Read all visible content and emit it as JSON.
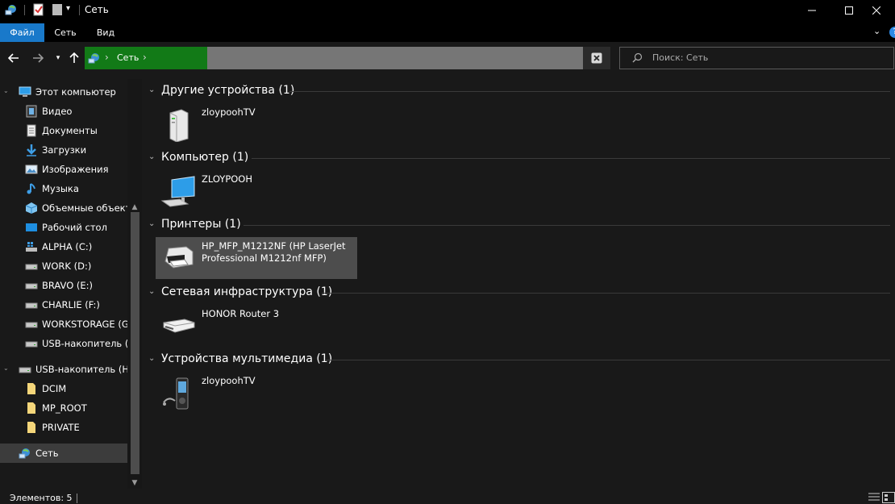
{
  "window": {
    "title": "Сеть"
  },
  "ribbon": {
    "tabs": [
      {
        "label": "Файл"
      },
      {
        "label": "Сеть"
      },
      {
        "label": "Вид"
      }
    ],
    "help": "?"
  },
  "address": {
    "location": "Сеть"
  },
  "search": {
    "placeholder": "Поиск: Сеть"
  },
  "sidebar": {
    "items": [
      {
        "label": "Этот компьютер",
        "icon": "computer-icon"
      },
      {
        "label": "Видео",
        "icon": "video-icon"
      },
      {
        "label": "Документы",
        "icon": "documents-icon"
      },
      {
        "label": "Загрузки",
        "icon": "downloads-icon"
      },
      {
        "label": "Изображения",
        "icon": "images-icon"
      },
      {
        "label": "Музыка",
        "icon": "music-icon"
      },
      {
        "label": "Объемные объекть",
        "icon": "3d-objects-icon"
      },
      {
        "label": "Рабочий стол",
        "icon": "desktop-icon"
      },
      {
        "label": "ALPHA (C:)",
        "icon": "system-drive-icon"
      },
      {
        "label": "WORK (D:)",
        "icon": "drive-icon"
      },
      {
        "label": "BRAVO (E:)",
        "icon": "drive-icon"
      },
      {
        "label": "CHARLIE (F:)",
        "icon": "drive-icon"
      },
      {
        "label": "WORKSTORAGE (G:)",
        "icon": "drive-icon"
      },
      {
        "label": "USB-накопитель (H",
        "icon": "usb-drive-icon"
      },
      {
        "label": "USB-накопитель (H:)",
        "icon": "usb-drive-icon"
      },
      {
        "label": "DCIM",
        "icon": "folder-icon"
      },
      {
        "label": "MP_ROOT",
        "icon": "folder-icon"
      },
      {
        "label": "PRIVATE",
        "icon": "folder-icon"
      },
      {
        "label": "Сеть",
        "icon": "network-icon"
      }
    ]
  },
  "groups": [
    {
      "title": "Другие устройства (1)",
      "items": [
        {
          "name": "zloypoohTV",
          "icon": "media-server-icon"
        }
      ]
    },
    {
      "title": "Компьютер (1)",
      "items": [
        {
          "name": "ZLOYPOOH",
          "icon": "computer-icon"
        }
      ]
    },
    {
      "title": "Принтеры (1)",
      "items": [
        {
          "name": "HP_MFP_M1212NF (HP LaserJet Professional M1212nf MFP)",
          "icon": "printer-icon"
        }
      ]
    },
    {
      "title": "Сетевая инфраструктура (1)",
      "items": [
        {
          "name": "HONOR Router 3",
          "icon": "router-icon"
        }
      ]
    },
    {
      "title": "Устройства мультимедиа (1)",
      "items": [
        {
          "name": "zloypoohTV",
          "icon": "media-player-icon"
        }
      ]
    }
  ],
  "status": {
    "items_count": "Элементов: 5"
  },
  "colors": {
    "address_progress": "#127a17",
    "file_tab": "#1979ca",
    "selected_tile": "#4d4d4d"
  }
}
